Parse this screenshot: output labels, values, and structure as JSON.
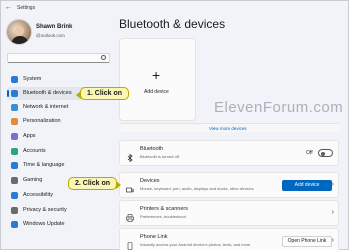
{
  "window": {
    "title": "Settings"
  },
  "profile": {
    "name": "Shawn Brink",
    "email": "@outlook.com"
  },
  "search": {
    "placeholder": ""
  },
  "nav": {
    "items": [
      {
        "label": "System",
        "icon": "system-icon",
        "color": "#2b7bd6"
      },
      {
        "label": "Bluetooth & devices",
        "icon": "bluetooth-icon",
        "color": "#2b7bd6"
      },
      {
        "label": "Network & internet",
        "icon": "network-icon",
        "color": "#3c8ed1"
      },
      {
        "label": "Personalization",
        "icon": "personalization-icon",
        "color": "#e08b3d"
      },
      {
        "label": "Apps",
        "icon": "apps-icon",
        "color": "#7a6fd0"
      },
      {
        "label": "Accounts",
        "icon": "accounts-icon",
        "color": "#2fa37b"
      },
      {
        "label": "Time & language",
        "icon": "time-language-icon",
        "color": "#2b7bd6"
      },
      {
        "label": "Gaming",
        "icon": "gaming-icon",
        "color": "#6b6b6b"
      },
      {
        "label": "Accessibility",
        "icon": "accessibility-icon",
        "color": "#2b7bd6"
      },
      {
        "label": "Privacy & security",
        "icon": "shield-icon",
        "color": "#6b6b6b"
      },
      {
        "label": "Windows Update",
        "icon": "windows-update-icon",
        "color": "#2b7bd6"
      }
    ]
  },
  "main": {
    "title": "Bluetooth & devices",
    "add_card": {
      "label": "Add device"
    },
    "view_more": "View more devices",
    "bluetooth": {
      "title": "Bluetooth",
      "subtitle": "Bluetooth is turned off",
      "toggle_label": "Off"
    },
    "devices": {
      "title": "Devices",
      "subtitle": "Mouse, keyboard, pen, audio, displays and docks, other devices",
      "button": "Add device"
    },
    "printers": {
      "title": "Printers & scanners",
      "subtitle": "Preferences, troubleshoot"
    },
    "phone": {
      "title": "Phone Link",
      "subtitle": "Instantly access your Android device's photos, texts, and more",
      "button": "Open Phone Link"
    }
  },
  "callouts": {
    "one": "1. Click on",
    "two": "2. Click on"
  },
  "watermark": "ElevenForum.com",
  "colors": {
    "accent": "#0067c0",
    "callout_bg": "#fbf6b4"
  }
}
